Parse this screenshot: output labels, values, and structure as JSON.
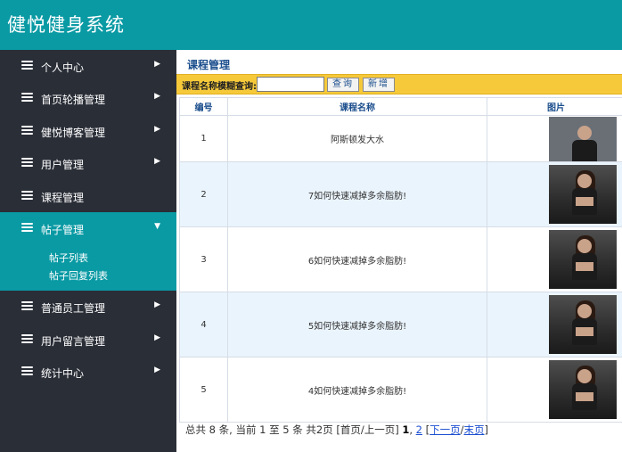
{
  "app": {
    "title": "健悦健身系统"
  },
  "sidebar": {
    "items": [
      {
        "label": "个人中心"
      },
      {
        "label": "首页轮播管理"
      },
      {
        "label": "健悦博客管理"
      },
      {
        "label": "用户管理"
      },
      {
        "label": "课程管理"
      },
      {
        "label": "帖子管理"
      },
      {
        "label": "普通员工管理"
      },
      {
        "label": "用户留言管理"
      },
      {
        "label": "统计中心"
      }
    ],
    "sub_items": [
      {
        "label": "帖子列表"
      },
      {
        "label": "帖子回复列表"
      }
    ],
    "active_index": 5
  },
  "main": {
    "breadcrumb": "课程管理",
    "search": {
      "label": "课程名称模糊查询:",
      "value": "",
      "placeholder": "",
      "search_label": "查询",
      "add_label": "新增"
    },
    "table": {
      "headers": {
        "id": "编号",
        "name": "课程名称",
        "image": "图片"
      },
      "rows": [
        {
          "id": "1",
          "name": "阿斯顿发大水",
          "image": "man-smoking-photo"
        },
        {
          "id": "2",
          "name": "7如何快速减掉多余脂肪!",
          "image": "fitness-woman-photo"
        },
        {
          "id": "3",
          "name": "6如何快速减掉多余脂肪!",
          "image": "fitness-woman-photo"
        },
        {
          "id": "4",
          "name": "5如何快速减掉多余脂肪!",
          "image": "fitness-woman-photo"
        },
        {
          "id": "5",
          "name": "4如何快速减掉多余脂肪!",
          "image": "fitness-woman-photo"
        }
      ]
    },
    "pager": {
      "summary": "总共 8 条, 当前 1 至 5 条 共2页",
      "first_prev": "[首页/上一页]",
      "page1": "1",
      "page2": "2",
      "next": "下一页",
      "last": "末页"
    }
  }
}
